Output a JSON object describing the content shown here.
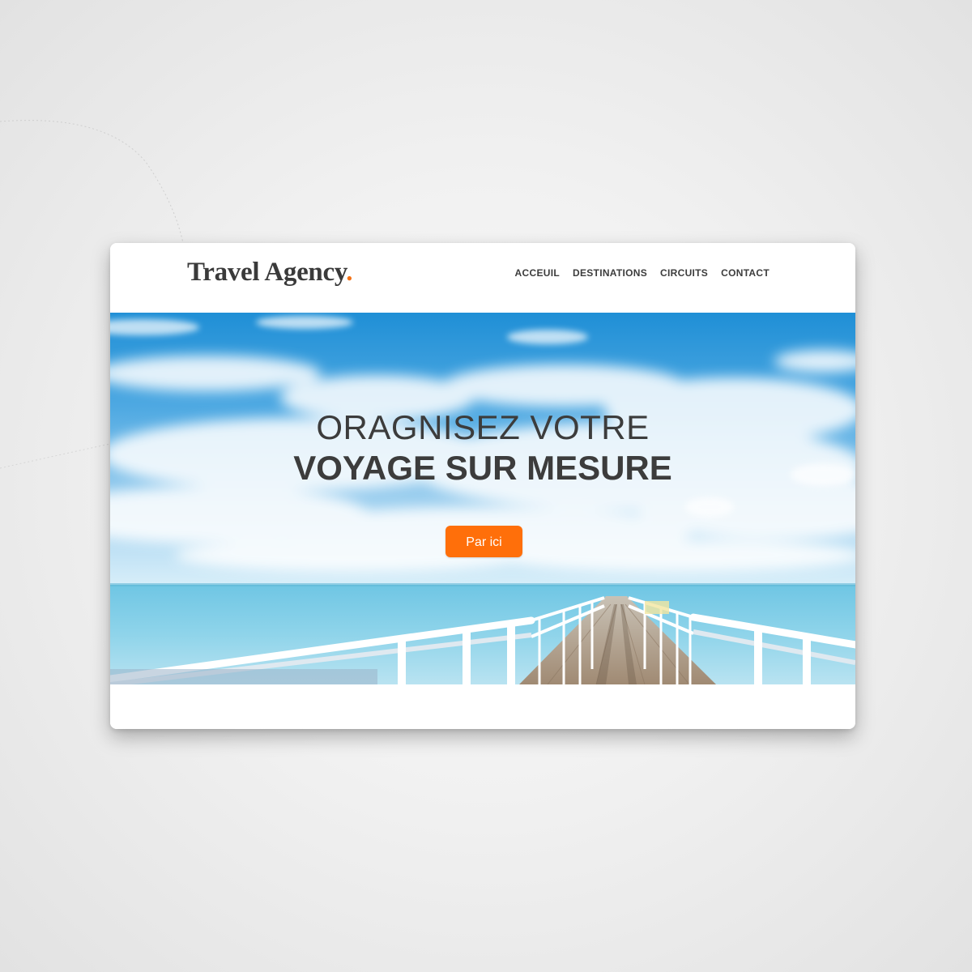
{
  "header": {
    "logo_text": "Travel Agency",
    "logo_dot": "."
  },
  "nav": {
    "items": [
      {
        "label": "ACCEUIL"
      },
      {
        "label": "DESTINATIONS"
      },
      {
        "label": "CIRCUITS"
      },
      {
        "label": "CONTACT"
      }
    ]
  },
  "hero": {
    "line1": "ORAGNISEZ VOTRE",
    "line2": "VOYAGE SUR MESURE",
    "cta_label": "Par ici",
    "image_subject": "blue sky with clouds over a calm sea and a long wooden pier with white railings"
  },
  "colors": {
    "accent": "#ff6f0a",
    "logo_dot": "#f47216",
    "text_dark": "#3c3c3c",
    "page_background": "#efefef",
    "card_background": "#ffffff"
  }
}
